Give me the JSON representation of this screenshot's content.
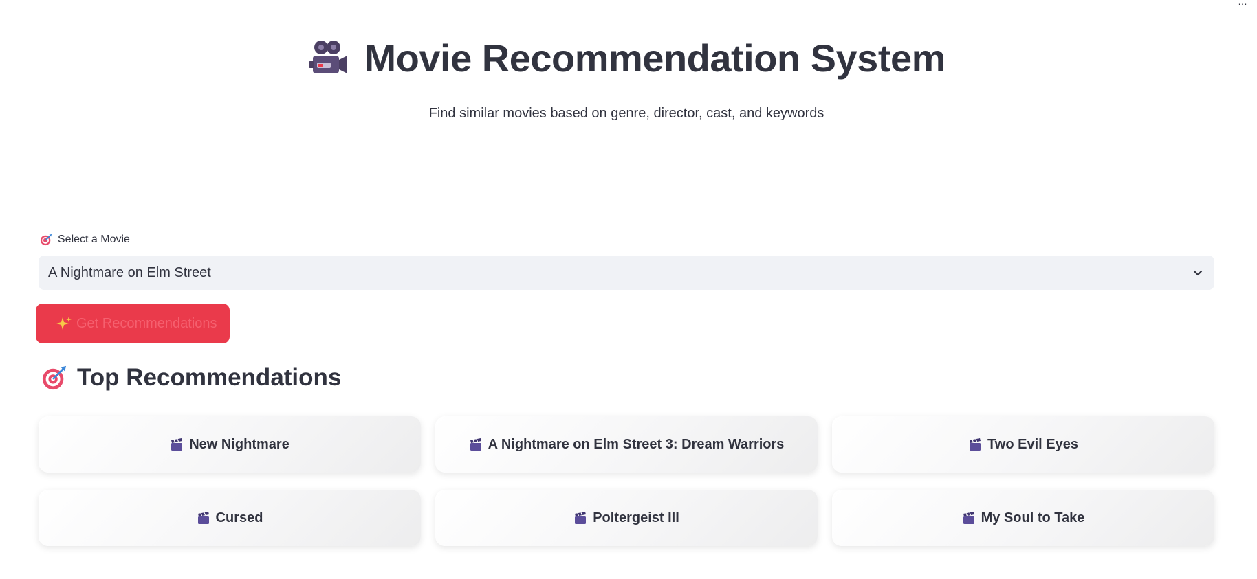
{
  "header": {
    "title": "Movie Recommendation System",
    "title_icon": "movie-camera-icon",
    "subtitle": "Find similar movies based on genre, director, cast, and keywords"
  },
  "selector": {
    "label": "Select a Movie",
    "label_icon": "target-icon",
    "selected_value": "A Nightmare on Elm Street",
    "dropdown_icon": "chevron-down-icon"
  },
  "action": {
    "button_label": "Get Recommendations",
    "button_icon": "sparkles-icon"
  },
  "recommendations": {
    "heading": "Top Recommendations",
    "heading_icon": "target-icon",
    "item_icon": "clapperboard-icon",
    "items": [
      "New Nightmare",
      "A Nightmare on Elm Street 3: Dream Warriors",
      "Two Evil Eyes",
      "Cursed",
      "Poltergeist III",
      "My Soul to Take"
    ]
  },
  "colors": {
    "accent": "#ea3a4b",
    "text": "#31333f",
    "select_bg": "#f0f2f6"
  }
}
